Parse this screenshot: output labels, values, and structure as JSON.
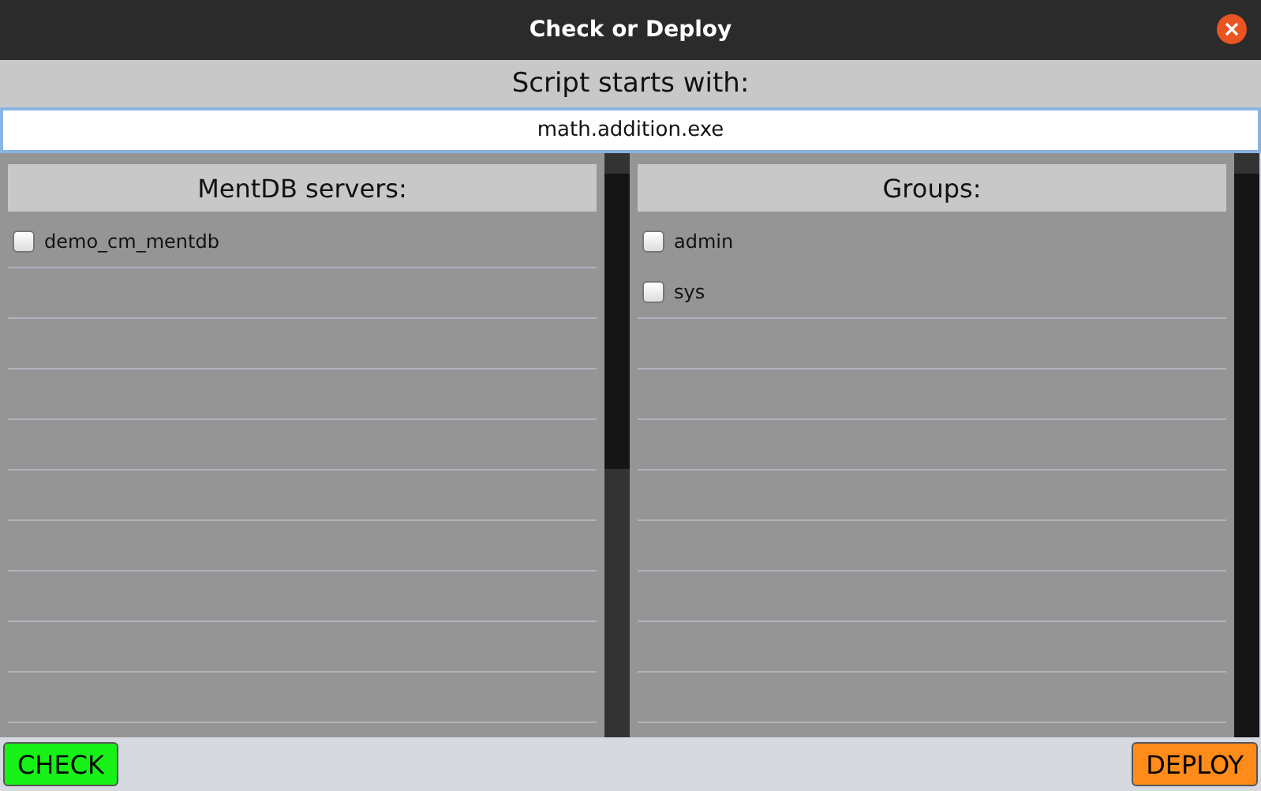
{
  "window": {
    "title": "Check or Deploy"
  },
  "script_filter": {
    "label": "Script starts with:",
    "value": "math.addition.exe"
  },
  "panels": [
    {
      "heading": "MentDB servers:",
      "items": [
        {
          "label": "demo_cm_mentdb",
          "checked": false
        }
      ]
    },
    {
      "heading": "Groups:",
      "items": [
        {
          "label": "admin",
          "checked": false
        },
        {
          "label": "sys",
          "checked": false
        }
      ]
    }
  ],
  "buttons": [
    {
      "label": "CHECK",
      "color": "#17f117"
    },
    {
      "label": "DEPLOY",
      "color": "#ff8c1a"
    }
  ]
}
